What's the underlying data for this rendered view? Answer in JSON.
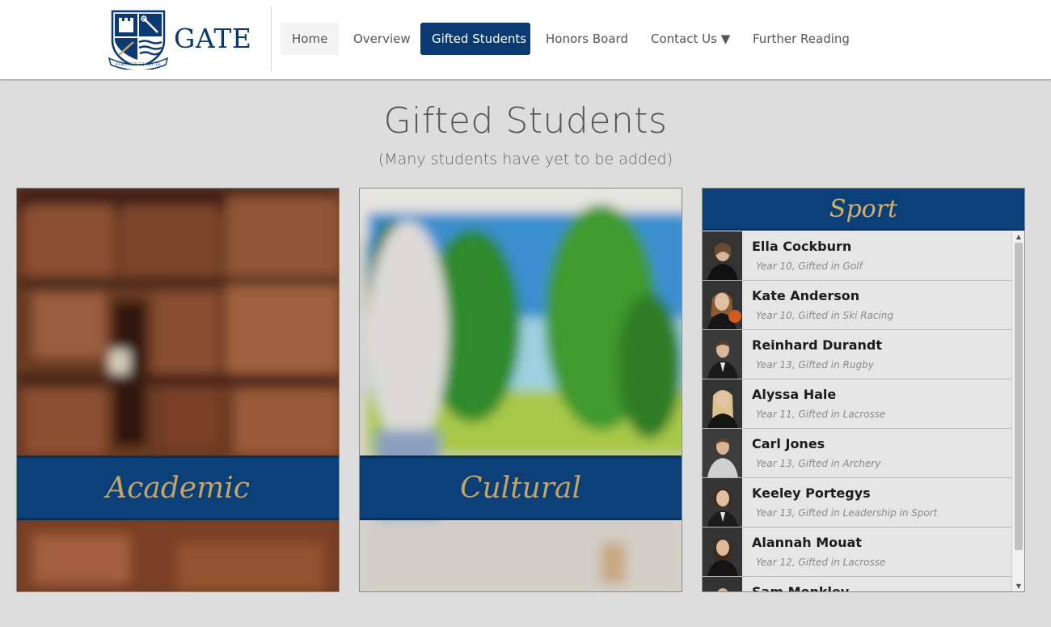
{
  "header": {
    "logo_text": "GATE",
    "logo_motto": "FORTITER ET RECTE",
    "nav": [
      {
        "label": "Home"
      },
      {
        "label": "Overview"
      },
      {
        "label": "Gifted Students"
      },
      {
        "label": "Honors Board"
      },
      {
        "label": "Contact Us ▼"
      },
      {
        "label": "Further Reading"
      }
    ],
    "active_nav": "Gifted Students",
    "accent_color": "#0b3a73"
  },
  "page": {
    "title": "Gifted Students",
    "subtitle": "(Many students have yet to be added)"
  },
  "categories": [
    {
      "label": "Academic"
    },
    {
      "label": "Cultural"
    }
  ],
  "sport": {
    "title": "Sport",
    "students": [
      {
        "name": "Ella Cockburn",
        "detail": "Year 10, Gifted in Golf"
      },
      {
        "name": "Kate Anderson",
        "detail": "Year 10, Gifted in Ski Racing"
      },
      {
        "name": "Reinhard Durandt",
        "detail": "Year 13, Gifted in Rugby"
      },
      {
        "name": "Alyssa Hale",
        "detail": "Year 11, Gifted in Lacrosse"
      },
      {
        "name": "Carl Jones",
        "detail": "Year 13, Gifted in Archery"
      },
      {
        "name": "Keeley Portegys",
        "detail": "Year 13, Gifted in Leadership in Sport"
      },
      {
        "name": "Alannah Mouat",
        "detail": "Year 12, Gifted in Lacrosse"
      },
      {
        "name": "Sam Monkley",
        "detail": ""
      }
    ]
  },
  "colors": {
    "banner": "#0b3f78",
    "banner_text": "#c6a463",
    "background": "#dddddd"
  }
}
